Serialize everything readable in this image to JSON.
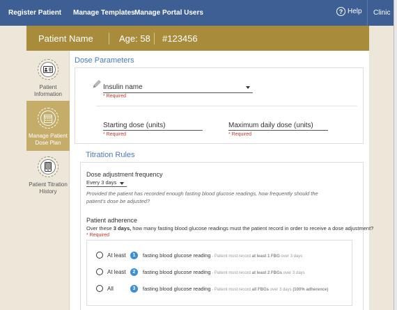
{
  "nav": {
    "items": [
      "Register Patient",
      "Manage Templates",
      "Manage Portal Users"
    ],
    "help": "Help",
    "help_icon": "?",
    "clinic": "Clinic"
  },
  "patient": {
    "name": "Patient Name",
    "age": "Age: 58",
    "id": "#123456"
  },
  "sidebar": {
    "items": [
      {
        "label_line1": "Patient",
        "label_line2": "Information",
        "icon": "id-card-icon",
        "active": false
      },
      {
        "label_line1": "Manage Patient",
        "label_line2": "Dose Plan",
        "icon": "calendar-icon",
        "active": true
      },
      {
        "label_line1": "Patient Titration",
        "label_line2": "History",
        "icon": "phone-history-icon",
        "active": false
      }
    ]
  },
  "dose_parameters": {
    "title": "Dose Parameters",
    "insulin": {
      "placeholder": "Insulin name",
      "required": "* Required"
    },
    "starting": {
      "label": "Starting dose (units)",
      "required": "* Required"
    },
    "maximum": {
      "label": "Maximum daily dose (units)",
      "required": "* Required"
    }
  },
  "titration_rules": {
    "title": "Titration Rules",
    "frequency": {
      "label": "Dose adjustment frequency",
      "value": "Every 3 days",
      "help_line1": "Provided the patient has recorded enough fasting blood glucose readings, how frequently should the",
      "help_line2": "patient's dose be adjusted?"
    },
    "adherence": {
      "label": "Patient adherence",
      "desc_prefix": "Over these ",
      "desc_bold": "3 days,",
      "desc_suffix": " how many fasting blood glucose readings must the patient record in order to receive a dose adjustment?",
      "required": "* Required",
      "options": [
        {
          "label": "At least",
          "number": "1",
          "text": "fasting blood glucose reading",
          "note_prefix": " - Patient must record ",
          "note_bold": "at least 1 FBG",
          "note_suffix": " over 3 days",
          "note_bold2": ""
        },
        {
          "label": "At least",
          "number": "2",
          "text": "fasting blood glucose reading",
          "note_prefix": " - Patient must record ",
          "note_bold": "at least 2 FBGs",
          "note_suffix": " over 3 days",
          "note_bold2": ""
        },
        {
          "label": "All",
          "number": "3",
          "text": "fasting blood glucose reading",
          "note_prefix": " - Patient must record ",
          "note_bold": "all FBGs",
          "note_suffix": " over 3 days ",
          "note_bold2": "(100% adherence)"
        }
      ]
    }
  },
  "colors": {
    "nav_bg": "#3e5f94",
    "patient_bar": "#a88b3b",
    "active_side": "#c5ac68",
    "section_title": "#4a78b8",
    "badge": "#3b8fd9",
    "required": "#c0392b"
  }
}
